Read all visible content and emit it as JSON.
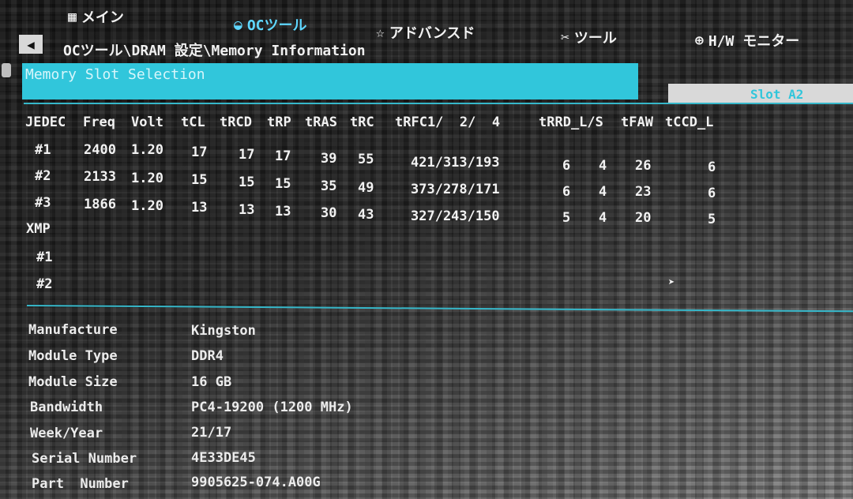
{
  "nav": {
    "main": {
      "label": "メイン",
      "icon": "grid-icon"
    },
    "oc": {
      "label": "OCツール",
      "icon": "oc-gauge-icon"
    },
    "advanced": {
      "label": "アドバンスド",
      "icon": "star-icon"
    },
    "tool": {
      "label": "ツール",
      "icon": "wrench-icon"
    },
    "hw": {
      "label": "H/W モニター",
      "icon": "monitor-icon"
    }
  },
  "breadcrumb": "OCツール\\DRAM 設定\\Memory Information",
  "slot_selection": {
    "label": "Memory Slot Selection",
    "value": "Slot A2"
  },
  "timings": {
    "headers": [
      "JEDEC",
      "Freq",
      "Volt",
      "tCL",
      "tRCD",
      "tRP",
      "tRAS",
      "tRC",
      "tRFC1/  2/  4",
      "tRRD_L/S",
      "tFAW",
      "tCCD_L"
    ],
    "jedec_rows": [
      {
        "id": "#1",
        "freq": "2400",
        "volt": "1.20",
        "tcl": "17",
        "trcd": "17",
        "trp": "17",
        "tras": "39",
        "trc": "55",
        "trfc": "421/313/193",
        "trrd_l": "6",
        "trrd_s": "4",
        "tfaw": "26",
        "tccd": "6"
      },
      {
        "id": "#2",
        "freq": "2133",
        "volt": "1.20",
        "tcl": "15",
        "trcd": "15",
        "trp": "15",
        "tras": "35",
        "trc": "49",
        "trfc": "373/278/171",
        "trrd_l": "6",
        "trrd_s": "4",
        "tfaw": "23",
        "tccd": "6"
      },
      {
        "id": "#3",
        "freq": "1866",
        "volt": "1.20",
        "tcl": "13",
        "trcd": "13",
        "trp": "13",
        "tras": "30",
        "trc": "43",
        "trfc": "327/243/150",
        "trrd_l": "5",
        "trrd_s": "4",
        "tfaw": "20",
        "tccd": "5"
      }
    ],
    "xmp_label": "XMP",
    "xmp_rows": [
      "#1",
      "#2"
    ]
  },
  "module_info": [
    {
      "label": "Manufacture",
      "value": "Kingston"
    },
    {
      "label": "Module Type",
      "value": "DDR4"
    },
    {
      "label": "Module Size",
      "value": "16 GB"
    },
    {
      "label": "Bandwidth",
      "value": "PC4-19200 (1200 MHz)"
    },
    {
      "label": "Week/Year",
      "value": "21/17"
    },
    {
      "label": "Serial Number",
      "value": "4E33DE45"
    },
    {
      "label": "Part  Number",
      "value": "9905625-074.A00G"
    }
  ],
  "colors": {
    "accent": "#31c6db",
    "text": "#e8e8e8"
  }
}
